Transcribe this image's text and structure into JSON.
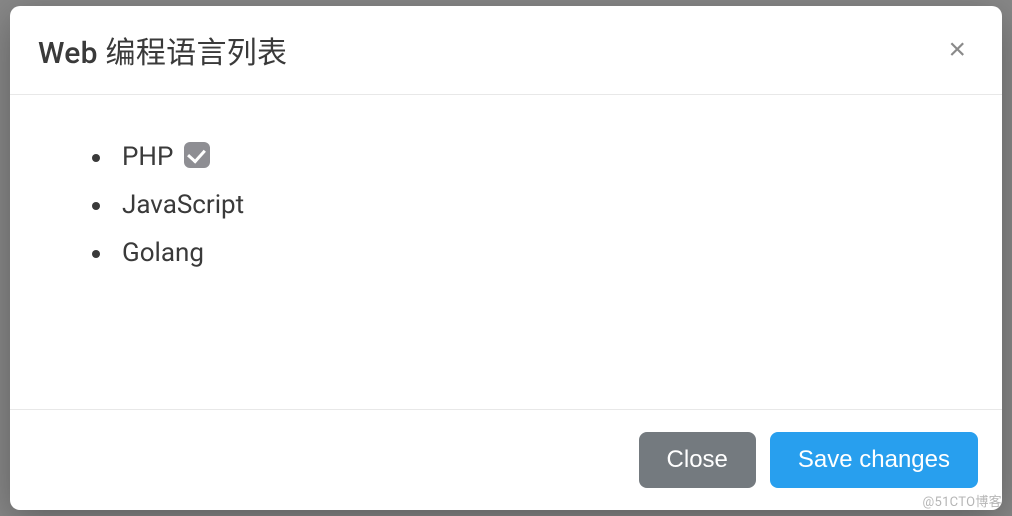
{
  "modal": {
    "title": "Web 编程语言列表",
    "languages": [
      {
        "name": "PHP",
        "checked": true
      },
      {
        "name": "JavaScript",
        "checked": false
      },
      {
        "name": "Golang",
        "checked": false
      }
    ],
    "close_label": "Close",
    "save_label": "Save changes"
  },
  "watermark": "@51CTO博客"
}
